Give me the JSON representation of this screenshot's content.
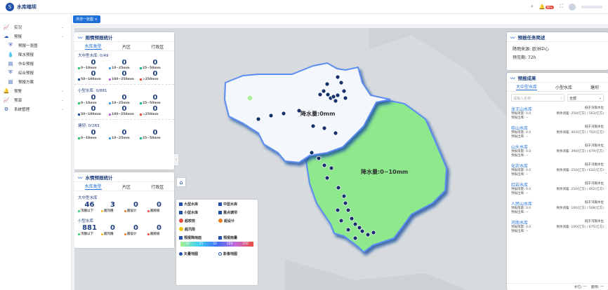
{
  "app": {
    "title": "水库缩坝"
  },
  "topbar": {
    "notif_count": "99+"
  },
  "tab": {
    "label": "洪涝一张图",
    "close": "×"
  },
  "sidebar": {
    "items": [
      {
        "label": "实况",
        "icon": "chart-icon",
        "expand": true
      },
      {
        "label": "预报",
        "icon": "cloud-icon",
        "expand": true
      },
      {
        "label": "预报一张图",
        "icon": "shield-icon",
        "sub": true
      },
      {
        "label": "降水预报",
        "icon": "drop-icon",
        "sub": true
      },
      {
        "label": "作业预报",
        "icon": "doc-icon",
        "sub": true
      },
      {
        "label": "综合预报",
        "icon": "shield-icon",
        "sub": true
      },
      {
        "label": "预报方案",
        "icon": "doc-icon",
        "sub": true
      },
      {
        "label": "预警",
        "icon": "bell-icon",
        "expand": true
      },
      {
        "label": "预演",
        "icon": "chart-icon",
        "expand": true
      },
      {
        "label": "系统管理",
        "icon": "gear-icon",
        "expand": true
      }
    ]
  },
  "rain_panel": {
    "title": "雨情预报统计",
    "tabs": [
      "水库类型",
      "片区",
      "行政区"
    ],
    "groups": [
      {
        "title": "大中型水库: 0/49",
        "row1": [
          "0",
          "0",
          "0"
        ],
        "row1_labels": [
          "0~10mm",
          "10~25mm",
          "25~50mm"
        ],
        "row2": [
          "0",
          "0",
          "0"
        ],
        "row2_labels": [
          "50~100mm",
          "100~250mm",
          ">250mm"
        ]
      },
      {
        "title": "小型水库: 0/881",
        "row1": [
          "0",
          "0",
          "0"
        ],
        "row1_labels": [
          "0~10mm",
          "10~25mm",
          "25~50mm"
        ],
        "row2": [
          "0",
          "0",
          "0"
        ],
        "row2_labels": [
          "50~100mm",
          "100~250mm",
          ">250mm"
        ]
      },
      {
        "title": "塘坝: 0/283",
        "row1": [
          "0",
          "0",
          "0"
        ],
        "row1_labels": [
          "0~10mm",
          "10~25mm",
          "25~50mm"
        ]
      }
    ]
  },
  "water_panel": {
    "title": "水情预报统计",
    "tabs": [
      "水库类型",
      "片区",
      "行政区"
    ],
    "groups": [
      {
        "title": "大中型水库",
        "values": [
          "46",
          "3",
          "0",
          "0"
        ],
        "labels": [
          "汛限以下",
          "超汛限",
          "超设计",
          "超校核"
        ]
      },
      {
        "title": "小型水库",
        "values": [
          "881",
          "0",
          "0",
          "0"
        ],
        "labels": [
          "汛限以下",
          "超汛限",
          "超设计",
          "超校核"
        ]
      }
    ]
  },
  "legend": {
    "rows": [
      [
        "大型水库",
        "中型水库"
      ],
      [
        "小型水库",
        "重点塘坝"
      ]
    ],
    "icons": [
      "超校核",
      "超设计",
      "超汛限"
    ],
    "bar_labels": [
      "预报降雨面",
      "预报雨量"
    ],
    "scale": [
      "10",
      "25",
      "50",
      "100",
      "250"
    ],
    "radios": [
      "矢量地图",
      "影像地图"
    ]
  },
  "map": {
    "labels": [
      "降水量:0mm",
      "降水量:0~10mm"
    ],
    "colors": {
      "green": "#8ee88c",
      "white": "#f4f7fb",
      "border": "#5c8df0"
    }
  },
  "task_panel": {
    "title": "预报任务简述",
    "source_label": "降雨来源:",
    "source": "欧洲中心",
    "period_label": "预见期:",
    "period": "72h"
  },
  "result_panel": {
    "title": "预报成果",
    "tabs": [
      "大中型水库",
      "小型水库",
      "塘坝"
    ],
    "search_placeholder": "请输入名称",
    "select": "全部",
    "items": [
      {
        "name": "龙王山水库",
        "status": "低于汛限水位",
        "rain": "0.0",
        "cap": "250(亿方) / 563(亿方)",
        "outflow": "--"
      },
      {
        "name": "桂山水库",
        "status": "低于汛限水位",
        "rain": "0.0",
        "cap": "403(亿方) / 702(亿方)",
        "outflow": "--"
      },
      {
        "name": "山头水库",
        "status": "低于汛限水位",
        "rain": "0.0",
        "cap": "394(亿方) / 679(亿方)",
        "outflow": "--"
      },
      {
        "name": "化农水库",
        "status": "低于汛限水位",
        "rain": "0.0",
        "cap": "250(亿方) / 632(亿方)",
        "outflow": "--"
      },
      {
        "name": "红岩水库",
        "status": "低于汛限水位",
        "rain": "0.0",
        "cap": "250(亿方) / 462(亿方)",
        "outflow": "--"
      },
      {
        "name": "人民山水库",
        "status": "低于汛限水位",
        "rain": "0.0",
        "cap": "100(亿方) / 508(亿方)",
        "outflow": "--"
      },
      {
        "name": "河南水库",
        "status": "低于汛限水位",
        "rain": "0.0",
        "cap": "100(亿方) / 675(亿方)",
        "outflow": "--"
      }
    ],
    "labels": {
      "rain": "预报雨量:",
      "cap": "剩余调蓄:",
      "outflow": "预报出库:"
    },
    "footer": [
      "水位: 一",
      "面雨: 一"
    ]
  }
}
